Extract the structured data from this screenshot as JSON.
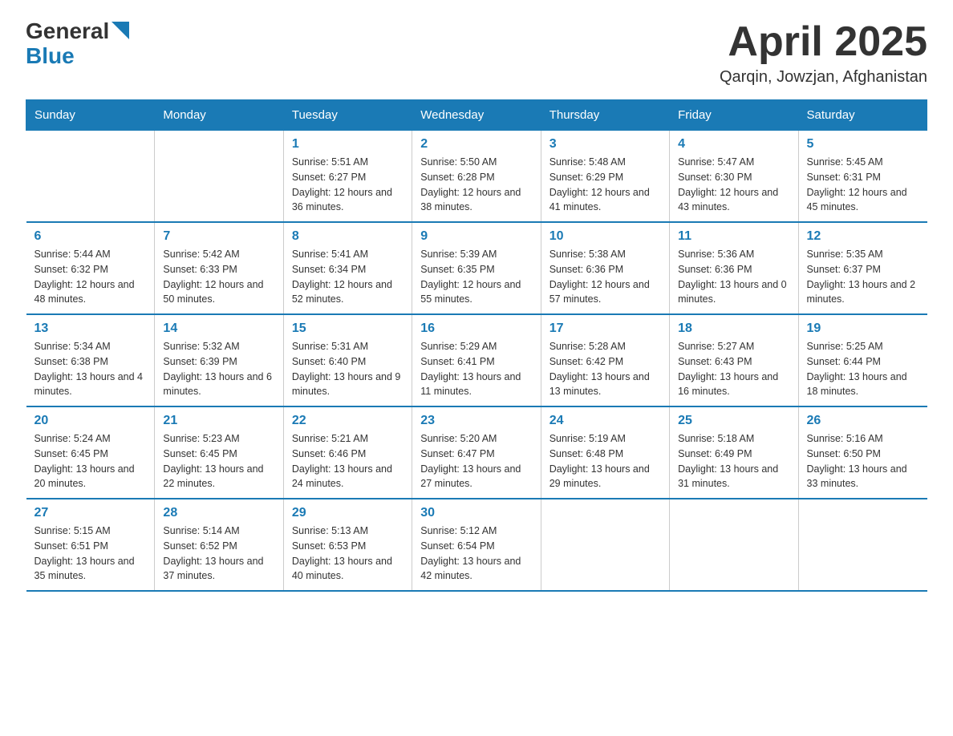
{
  "header": {
    "logo_general": "General",
    "logo_blue": "Blue",
    "month": "April 2025",
    "location": "Qarqin, Jowzjan, Afghanistan"
  },
  "days_of_week": [
    "Sunday",
    "Monday",
    "Tuesday",
    "Wednesday",
    "Thursday",
    "Friday",
    "Saturday"
  ],
  "weeks": [
    [
      {
        "day": "",
        "info": ""
      },
      {
        "day": "",
        "info": ""
      },
      {
        "day": "1",
        "info": "Sunrise: 5:51 AM\nSunset: 6:27 PM\nDaylight: 12 hours\nand 36 minutes."
      },
      {
        "day": "2",
        "info": "Sunrise: 5:50 AM\nSunset: 6:28 PM\nDaylight: 12 hours\nand 38 minutes."
      },
      {
        "day": "3",
        "info": "Sunrise: 5:48 AM\nSunset: 6:29 PM\nDaylight: 12 hours\nand 41 minutes."
      },
      {
        "day": "4",
        "info": "Sunrise: 5:47 AM\nSunset: 6:30 PM\nDaylight: 12 hours\nand 43 minutes."
      },
      {
        "day": "5",
        "info": "Sunrise: 5:45 AM\nSunset: 6:31 PM\nDaylight: 12 hours\nand 45 minutes."
      }
    ],
    [
      {
        "day": "6",
        "info": "Sunrise: 5:44 AM\nSunset: 6:32 PM\nDaylight: 12 hours\nand 48 minutes."
      },
      {
        "day": "7",
        "info": "Sunrise: 5:42 AM\nSunset: 6:33 PM\nDaylight: 12 hours\nand 50 minutes."
      },
      {
        "day": "8",
        "info": "Sunrise: 5:41 AM\nSunset: 6:34 PM\nDaylight: 12 hours\nand 52 minutes."
      },
      {
        "day": "9",
        "info": "Sunrise: 5:39 AM\nSunset: 6:35 PM\nDaylight: 12 hours\nand 55 minutes."
      },
      {
        "day": "10",
        "info": "Sunrise: 5:38 AM\nSunset: 6:36 PM\nDaylight: 12 hours\nand 57 minutes."
      },
      {
        "day": "11",
        "info": "Sunrise: 5:36 AM\nSunset: 6:36 PM\nDaylight: 13 hours\nand 0 minutes."
      },
      {
        "day": "12",
        "info": "Sunrise: 5:35 AM\nSunset: 6:37 PM\nDaylight: 13 hours\nand 2 minutes."
      }
    ],
    [
      {
        "day": "13",
        "info": "Sunrise: 5:34 AM\nSunset: 6:38 PM\nDaylight: 13 hours\nand 4 minutes."
      },
      {
        "day": "14",
        "info": "Sunrise: 5:32 AM\nSunset: 6:39 PM\nDaylight: 13 hours\nand 6 minutes."
      },
      {
        "day": "15",
        "info": "Sunrise: 5:31 AM\nSunset: 6:40 PM\nDaylight: 13 hours\nand 9 minutes."
      },
      {
        "day": "16",
        "info": "Sunrise: 5:29 AM\nSunset: 6:41 PM\nDaylight: 13 hours\nand 11 minutes."
      },
      {
        "day": "17",
        "info": "Sunrise: 5:28 AM\nSunset: 6:42 PM\nDaylight: 13 hours\nand 13 minutes."
      },
      {
        "day": "18",
        "info": "Sunrise: 5:27 AM\nSunset: 6:43 PM\nDaylight: 13 hours\nand 16 minutes."
      },
      {
        "day": "19",
        "info": "Sunrise: 5:25 AM\nSunset: 6:44 PM\nDaylight: 13 hours\nand 18 minutes."
      }
    ],
    [
      {
        "day": "20",
        "info": "Sunrise: 5:24 AM\nSunset: 6:45 PM\nDaylight: 13 hours\nand 20 minutes."
      },
      {
        "day": "21",
        "info": "Sunrise: 5:23 AM\nSunset: 6:45 PM\nDaylight: 13 hours\nand 22 minutes."
      },
      {
        "day": "22",
        "info": "Sunrise: 5:21 AM\nSunset: 6:46 PM\nDaylight: 13 hours\nand 24 minutes."
      },
      {
        "day": "23",
        "info": "Sunrise: 5:20 AM\nSunset: 6:47 PM\nDaylight: 13 hours\nand 27 minutes."
      },
      {
        "day": "24",
        "info": "Sunrise: 5:19 AM\nSunset: 6:48 PM\nDaylight: 13 hours\nand 29 minutes."
      },
      {
        "day": "25",
        "info": "Sunrise: 5:18 AM\nSunset: 6:49 PM\nDaylight: 13 hours\nand 31 minutes."
      },
      {
        "day": "26",
        "info": "Sunrise: 5:16 AM\nSunset: 6:50 PM\nDaylight: 13 hours\nand 33 minutes."
      }
    ],
    [
      {
        "day": "27",
        "info": "Sunrise: 5:15 AM\nSunset: 6:51 PM\nDaylight: 13 hours\nand 35 minutes."
      },
      {
        "day": "28",
        "info": "Sunrise: 5:14 AM\nSunset: 6:52 PM\nDaylight: 13 hours\nand 37 minutes."
      },
      {
        "day": "29",
        "info": "Sunrise: 5:13 AM\nSunset: 6:53 PM\nDaylight: 13 hours\nand 40 minutes."
      },
      {
        "day": "30",
        "info": "Sunrise: 5:12 AM\nSunset: 6:54 PM\nDaylight: 13 hours\nand 42 minutes."
      },
      {
        "day": "",
        "info": ""
      },
      {
        "day": "",
        "info": ""
      },
      {
        "day": "",
        "info": ""
      }
    ]
  ]
}
